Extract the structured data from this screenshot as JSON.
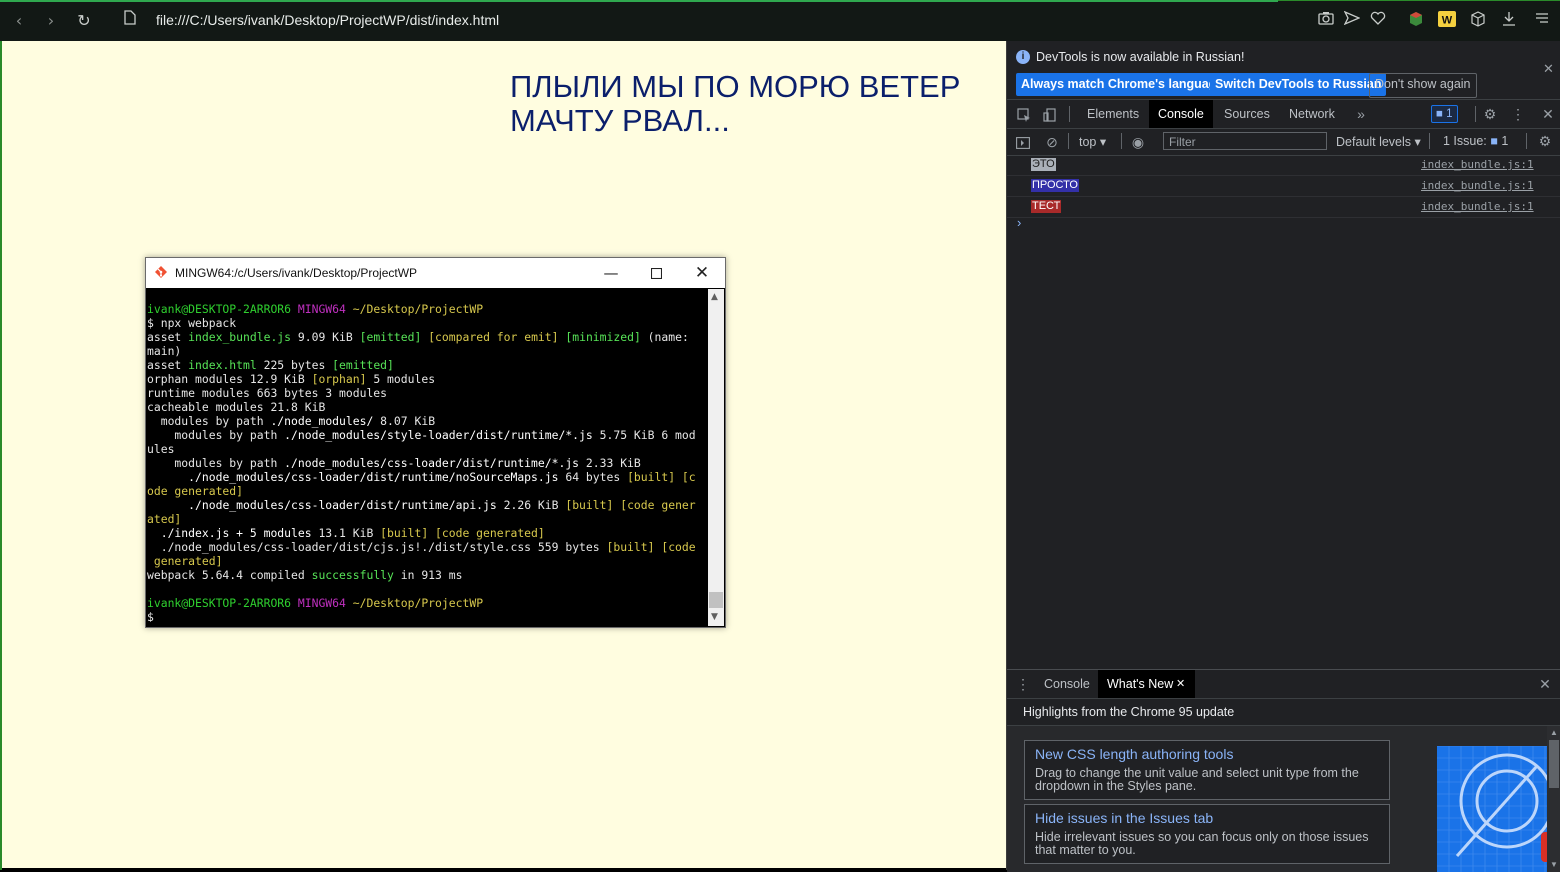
{
  "browser": {
    "url": "file:///C:/Users/ivank/Desktop/ProjectWP/dist/index.html",
    "icons": [
      "back-icon",
      "forward-icon",
      "reload-icon",
      "page-icon",
      "camera-icon",
      "send-icon",
      "heart-icon",
      "extension-icon",
      "w-extension-icon",
      "cube-icon",
      "download-icon",
      "menu-icon"
    ]
  },
  "page": {
    "heading": "ПЛЫЛИ МЫ ПО МОРЮ ВЕТЕР МАЧТУ РВАЛ..."
  },
  "terminal": {
    "title": "MINGW64:/c/Users/ivank/Desktop/ProjectWP",
    "user": "ivank@DESKTOP-2ARROR6",
    "shell": "MINGW64",
    "path": "~/Desktop/ProjectWP",
    "command": "$ npx webpack",
    "output": {
      "asset1_a": "asset ",
      "asset1_file": "index_bundle.js",
      "asset1_size": " 9.09 KiB ",
      "asset1_emitted": "[emitted]",
      "asset1_compared": "[compared for emit]",
      "asset1_min": "[minimized]",
      "asset1_name": " (name:",
      "asset1_main": "main)",
      "asset2_a": "asset ",
      "asset2_file": "index.html",
      "asset2_size": " 225 bytes ",
      "asset2_emitted": "[emitted]",
      "orphan_a": "orphan modules 12.9 KiB ",
      "orphan_tag": "[orphan]",
      "orphan_b": " 5 modules",
      "runtime": "runtime modules 663 bytes 3 modules",
      "cacheable": "cacheable modules 21.8 KiB",
      "nm_a": "  modules by path ",
      "nm_path": "./node_modules/",
      "nm_b": " 8.07 KiB",
      "sl_a": "    modules by path ",
      "sl_path": "./node_modules/style-loader/dist/runtime/*.js",
      "sl_b": " 5.75 KiB 6 mod",
      "sl_c": "ules",
      "cl_a": "    modules by path ",
      "cl_path": "./node_modules/css-loader/dist/runtime/*.js",
      "cl_b": " 2.33 KiB",
      "ns_a": "      ",
      "ns_path": "./node_modules/css-loader/dist/runtime/noSourceMaps.js",
      "ns_b": " 64 bytes ",
      "ns_built": "[built] [c",
      "ns_c": "ode generated]",
      "api_a": "      ",
      "api_path": "./node_modules/css-loader/dist/runtime/api.js",
      "api_b": " 2.26 KiB ",
      "api_built": "[built] [code gener",
      "api_c": "ated]",
      "idx_a": "  ",
      "idx_path": "./index.js + 5 modules",
      "idx_b": " 13.1 KiB ",
      "idx_built": "[built] [code generated]",
      "css_a": "  ",
      "css_path": "./node_modules/css-loader/dist/cjs.js!./dist/style.css",
      "css_b": " 559 bytes ",
      "css_built": "[built] [code",
      "css_c": " generated]",
      "wp_a": "webpack 5.64.4 compiled ",
      "wp_ok": "successfully",
      "wp_b": " in 913 ms",
      "prompt": "$"
    }
  },
  "devtools": {
    "banner": {
      "text": "DevTools is now available in Russian!",
      "btn_match": "Always match Chrome's language",
      "btn_switch": "Switch DevTools to Russian",
      "btn_dont": "Don't show again"
    },
    "tabs": [
      "Elements",
      "Console",
      "Sources",
      "Network"
    ],
    "active_tab": "Console",
    "issues_badge": "1",
    "filterbar": {
      "context": "top",
      "filter_placeholder": "Filter",
      "levels": "Default levels",
      "issues_label": "1 Issue:",
      "issues_count": "1"
    },
    "console_lines": [
      {
        "text": "ЭТО",
        "bg": "#aab0b8",
        "fg": "#1e1e1e",
        "source": "index_bundle.js:1"
      },
      {
        "text": "ПРОСТО",
        "bg": "#3330a8",
        "fg": "#ffffff",
        "source": "index_bundle.js:1"
      },
      {
        "text": "ТЕСТ",
        "bg": "#a82a2a",
        "fg": "#ffffff",
        "source": "index_bundle.js:1"
      }
    ],
    "drawer": {
      "tabs": [
        "Console",
        "What's New"
      ],
      "active_tab": "What's New",
      "subtitle": "Highlights from the Chrome 95 update",
      "cards": [
        {
          "title": "New CSS length authoring tools",
          "desc": "Drag to change the unit value and select unit type from the dropdown in the Styles pane."
        },
        {
          "title": "Hide issues in the Issues tab",
          "desc": "Hide irrelevant issues so you can focus only on those issues that matter to you."
        }
      ]
    }
  }
}
